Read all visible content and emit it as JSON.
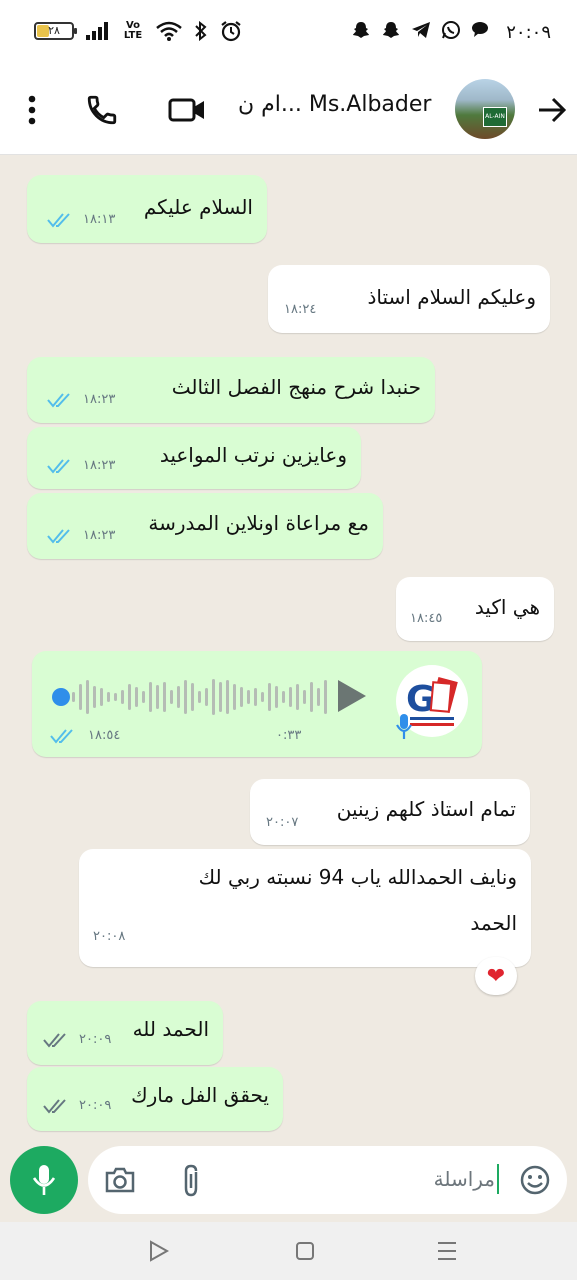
{
  "status_bar": {
    "time": "٢٠:٠٩",
    "battery_level": "٢٨",
    "network_label": "Vo LTE"
  },
  "header": {
    "title": "ام ن... Ms.Albader",
    "avatar_sign_text": "AL-AIN"
  },
  "messages": [
    {
      "text": "السلام عليكم",
      "time": "١٨:١٣"
    },
    {
      "text": "وعليكم السلام استاذ",
      "time": "١٨:٢٤"
    },
    {
      "text": "حنبدا شرح منهج الفصل الثالث",
      "time": "١٨:٢٣"
    },
    {
      "text": "وعايزين نرتب المواعيد",
      "time": "١٨:٢٣"
    },
    {
      "text": "مع مراعاة اونلاين المدرسة",
      "time": "١٨:٢٣"
    },
    {
      "text": "هي اكيد",
      "time": "١٨:٤٥"
    },
    {
      "duration": "٠:٣٣",
      "time": "١٨:٥٤"
    },
    {
      "text": "تمام استاذ كلهم زينين",
      "time": "٢٠:٠٧"
    },
    {
      "line1": "ونايف الحمدالله ياب 94 نسبته ربي لك",
      "line2": "الحمد",
      "time": "٢٠:٠٨",
      "reaction": "❤"
    },
    {
      "text": "الحمد لله",
      "time": "٢٠:٠٩"
    },
    {
      "text": "يحقق الفل مارك",
      "time": "٢٠:٠٩"
    }
  ],
  "input": {
    "placeholder": "مراسلة"
  },
  "colors": {
    "outgoing_bubble": "#d9fdd3",
    "incoming_bubble": "#ffffff",
    "accent": "#1daa61",
    "read_tick": "#53bdeb",
    "chat_background": "#efeae2"
  }
}
